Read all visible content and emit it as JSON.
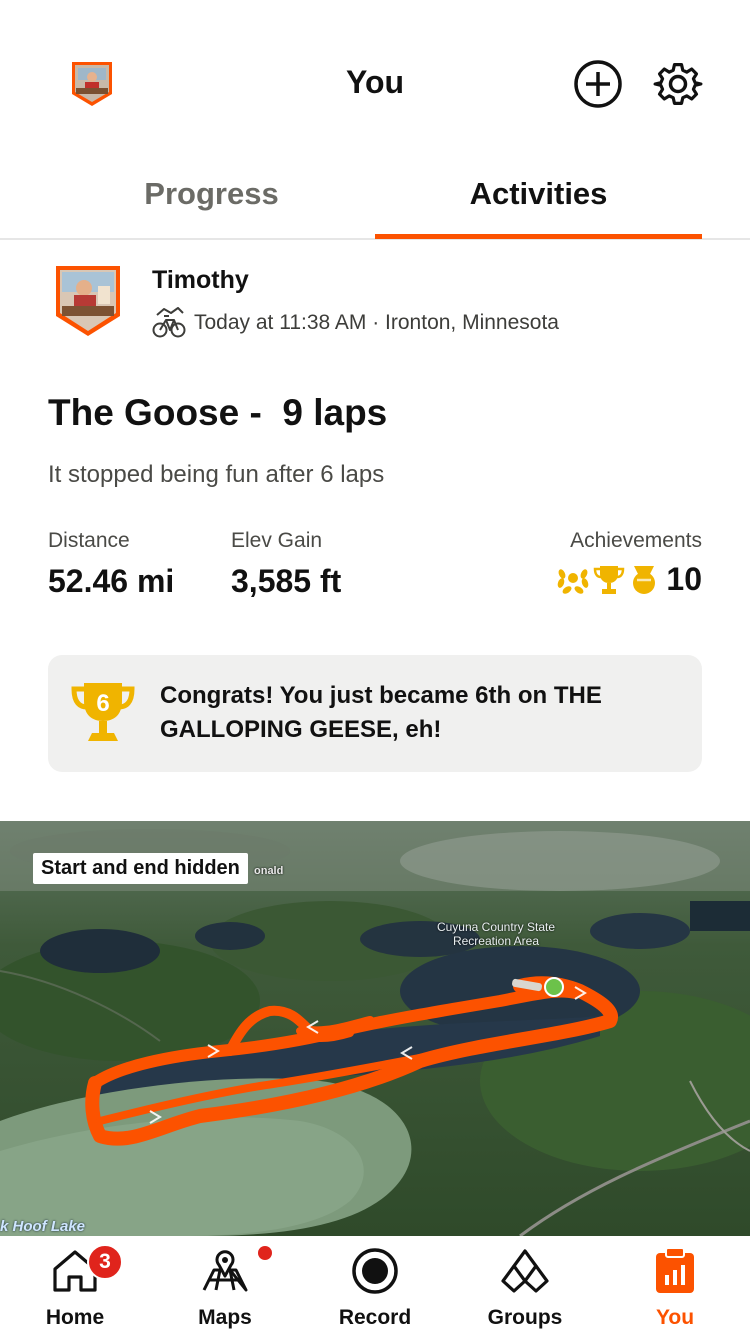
{
  "header": {
    "title": "You",
    "add_icon": "plus-circle-icon",
    "settings_icon": "gear-icon"
  },
  "tabs": [
    {
      "label": "Progress",
      "active": false
    },
    {
      "label": "Activities",
      "active": true
    }
  ],
  "activity": {
    "athlete_name": "Timothy",
    "sport_icon": "bike-icon",
    "meta": "Today at 11:38 AM · Ironton, Minnesota",
    "title": "The Goose -  9 laps",
    "description": "It stopped being fun after 6 laps",
    "stats": {
      "distance_label": "Distance",
      "distance_value": "52.46 mi",
      "elev_label": "Elev Gain",
      "elev_value": "3,585 ft",
      "achievements_label": "Achievements",
      "achievements_value": "10"
    },
    "congrats": {
      "rank": "6",
      "text": "Congrats! You just became 6th on THE GALLOPING GEESE, eh!"
    }
  },
  "map": {
    "privacy_badge": "Start and end hidden",
    "label_partial": "onald",
    "label_recreation": "Cuyuna Country State Recreation Area",
    "label_lake": "k Hoof Lake"
  },
  "colors": {
    "accent": "#fc5200",
    "gold": "#f0b400",
    "badge_red": "#e0241c"
  },
  "bottom_nav": [
    {
      "label": "Home",
      "icon": "home-icon",
      "badge": "3"
    },
    {
      "label": "Maps",
      "icon": "maps-icon",
      "dot": true
    },
    {
      "label": "Record",
      "icon": "record-icon"
    },
    {
      "label": "Groups",
      "icon": "groups-icon"
    },
    {
      "label": "You",
      "icon": "you-icon",
      "active": true
    }
  ]
}
